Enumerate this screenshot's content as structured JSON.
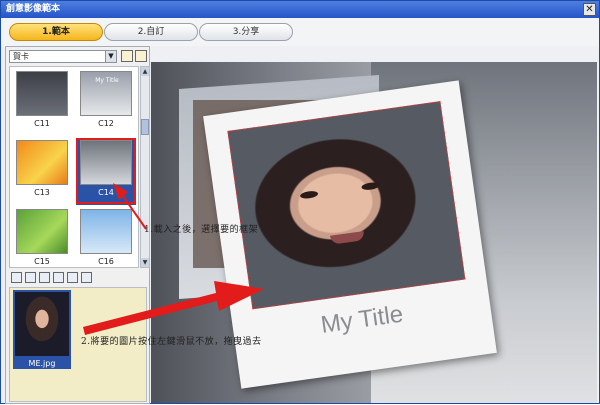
{
  "window": {
    "title": "創意影像範本",
    "close_glyph": "✕"
  },
  "steps": [
    {
      "label": "1.範本",
      "active": true
    },
    {
      "label": "2.自訂",
      "active": false
    },
    {
      "label": "3.分享",
      "active": false
    }
  ],
  "template_panel": {
    "category": "賀卡",
    "templates": [
      {
        "label": "C11",
        "title": ""
      },
      {
        "label": "C12",
        "title": "My Title"
      },
      {
        "label": "C13",
        "title": ""
      },
      {
        "label": "C14",
        "title": ""
      },
      {
        "label": "C15",
        "title": ""
      },
      {
        "label": "C16",
        "title": ""
      }
    ],
    "selected": "C14"
  },
  "photo_panel": {
    "file_name": "ME.jpg"
  },
  "preview": {
    "card_title": "My Title"
  },
  "annotations": {
    "step1": "1.載入之後，選擇要的框架",
    "step2": "2.將要的圖片按住左鍵滑鼠不放，拖曳過去"
  },
  "colors": {
    "accent_tab": "#f5b51d",
    "selection": "#2a53a7",
    "annotation_arrow": "#e21b1b",
    "titlebar": "#2554c7"
  }
}
